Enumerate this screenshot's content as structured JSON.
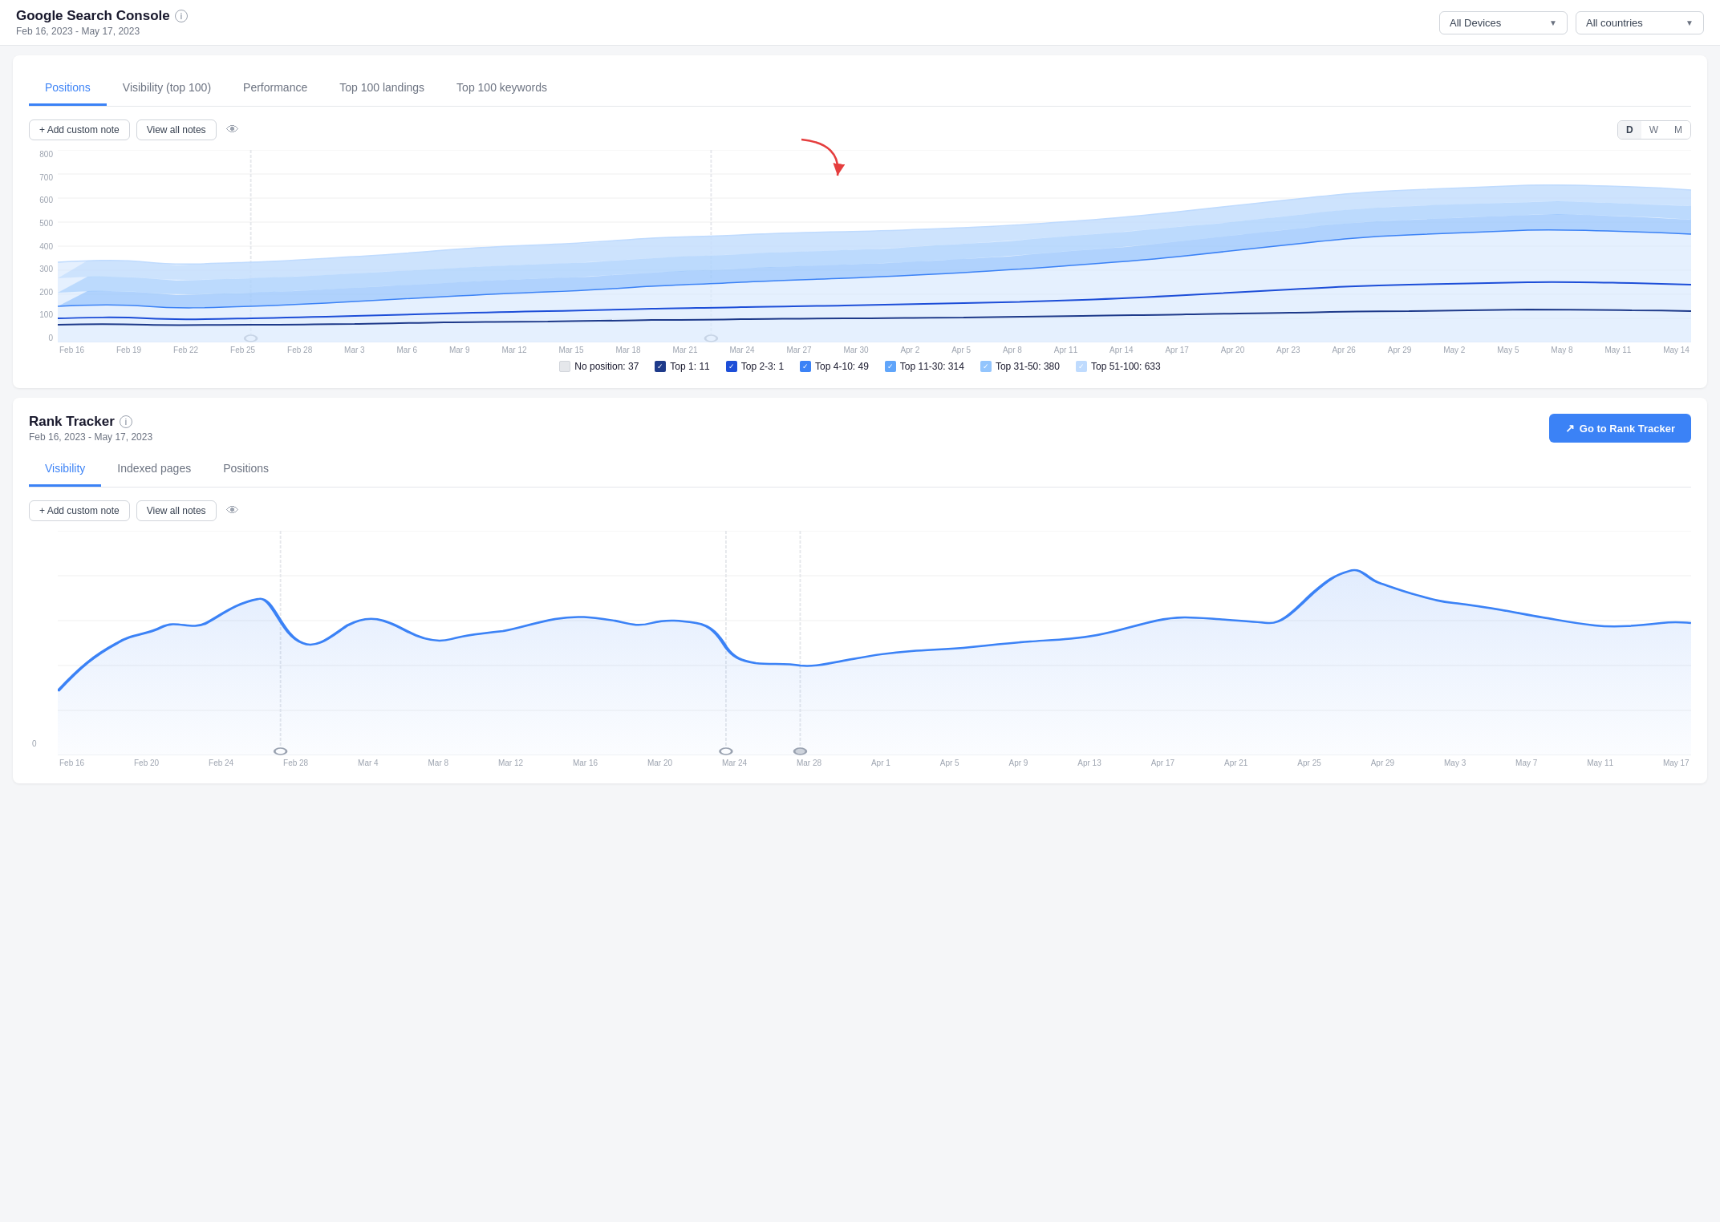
{
  "app": {
    "title": "Google Search Console",
    "title_info": "i",
    "date_range": "Feb 16, 2023 - May 17, 2023"
  },
  "filters": {
    "devices_label": "All Devices",
    "countries_label": "All countries"
  },
  "gsc_section": {
    "tabs": [
      {
        "id": "positions",
        "label": "Positions",
        "active": true
      },
      {
        "id": "visibility",
        "label": "Visibility (top 100)",
        "active": false
      },
      {
        "id": "performance",
        "label": "Performance",
        "active": false
      },
      {
        "id": "landings",
        "label": "Top 100 landings",
        "active": false
      },
      {
        "id": "keywords",
        "label": "Top 100 keywords",
        "active": false
      }
    ],
    "add_note_label": "+ Add custom note",
    "view_notes_label": "View all notes",
    "period_buttons": [
      "D",
      "W",
      "M"
    ],
    "active_period": "D",
    "y_axis": [
      "800",
      "700",
      "600",
      "500",
      "400",
      "300",
      "200",
      "100",
      "0"
    ],
    "x_axis": [
      "Feb 16",
      "Feb 19",
      "Feb 22",
      "Feb 25",
      "Feb 28",
      "Mar 3",
      "Mar 6",
      "Mar 9",
      "Mar 12",
      "Mar 15",
      "Mar 18",
      "Mar 21",
      "Mar 24",
      "Mar 27",
      "Mar 30",
      "Apr 2",
      "Apr 5",
      "Apr 8",
      "Apr 11",
      "Apr 14",
      "Apr 17",
      "Apr 20",
      "Apr 23",
      "Apr 26",
      "Apr 29",
      "May 2",
      "May 5",
      "May 8",
      "May 11",
      "May 14"
    ],
    "legend": [
      {
        "label": "No position: 37",
        "color": "#e5e7eb",
        "checked": false
      },
      {
        "label": "Top 1: 11",
        "color": "#1e40af",
        "checked": true
      },
      {
        "label": "Top 2-3: 1",
        "color": "#3b82f6",
        "checked": true
      },
      {
        "label": "Top 4-10: 49",
        "color": "#60a5fa",
        "checked": true
      },
      {
        "label": "Top 11-30: 314",
        "color": "#93c5fd",
        "checked": true
      },
      {
        "label": "Top 31-50: 380",
        "color": "#bfdbfe",
        "checked": true
      },
      {
        "label": "Top 51-100: 633",
        "color": "#dbeafe",
        "checked": true
      }
    ]
  },
  "rank_tracker": {
    "title": "Rank Tracker",
    "date_range": "Feb 16, 2023 - May 17, 2023",
    "go_button": "Go to Rank Tracker",
    "tabs": [
      {
        "id": "visibility",
        "label": "Visibility",
        "active": true
      },
      {
        "id": "indexed",
        "label": "Indexed pages",
        "active": false
      },
      {
        "id": "positions",
        "label": "Positions",
        "active": false
      }
    ],
    "add_note_label": "+ Add custom note",
    "view_notes_label": "View all notes",
    "x_axis": [
      "Feb 16",
      "Feb 20",
      "Feb 24",
      "Feb 28",
      "Mar 4",
      "Mar 8",
      "Mar 12",
      "Mar 16",
      "Mar 20",
      "Mar 24",
      "Mar 28",
      "Apr 1",
      "Apr 5",
      "Apr 9",
      "Apr 13",
      "Apr 17",
      "Apr 21",
      "Apr 25",
      "Apr 29",
      "May 3",
      "May 7",
      "May 11",
      "May 17"
    ]
  }
}
